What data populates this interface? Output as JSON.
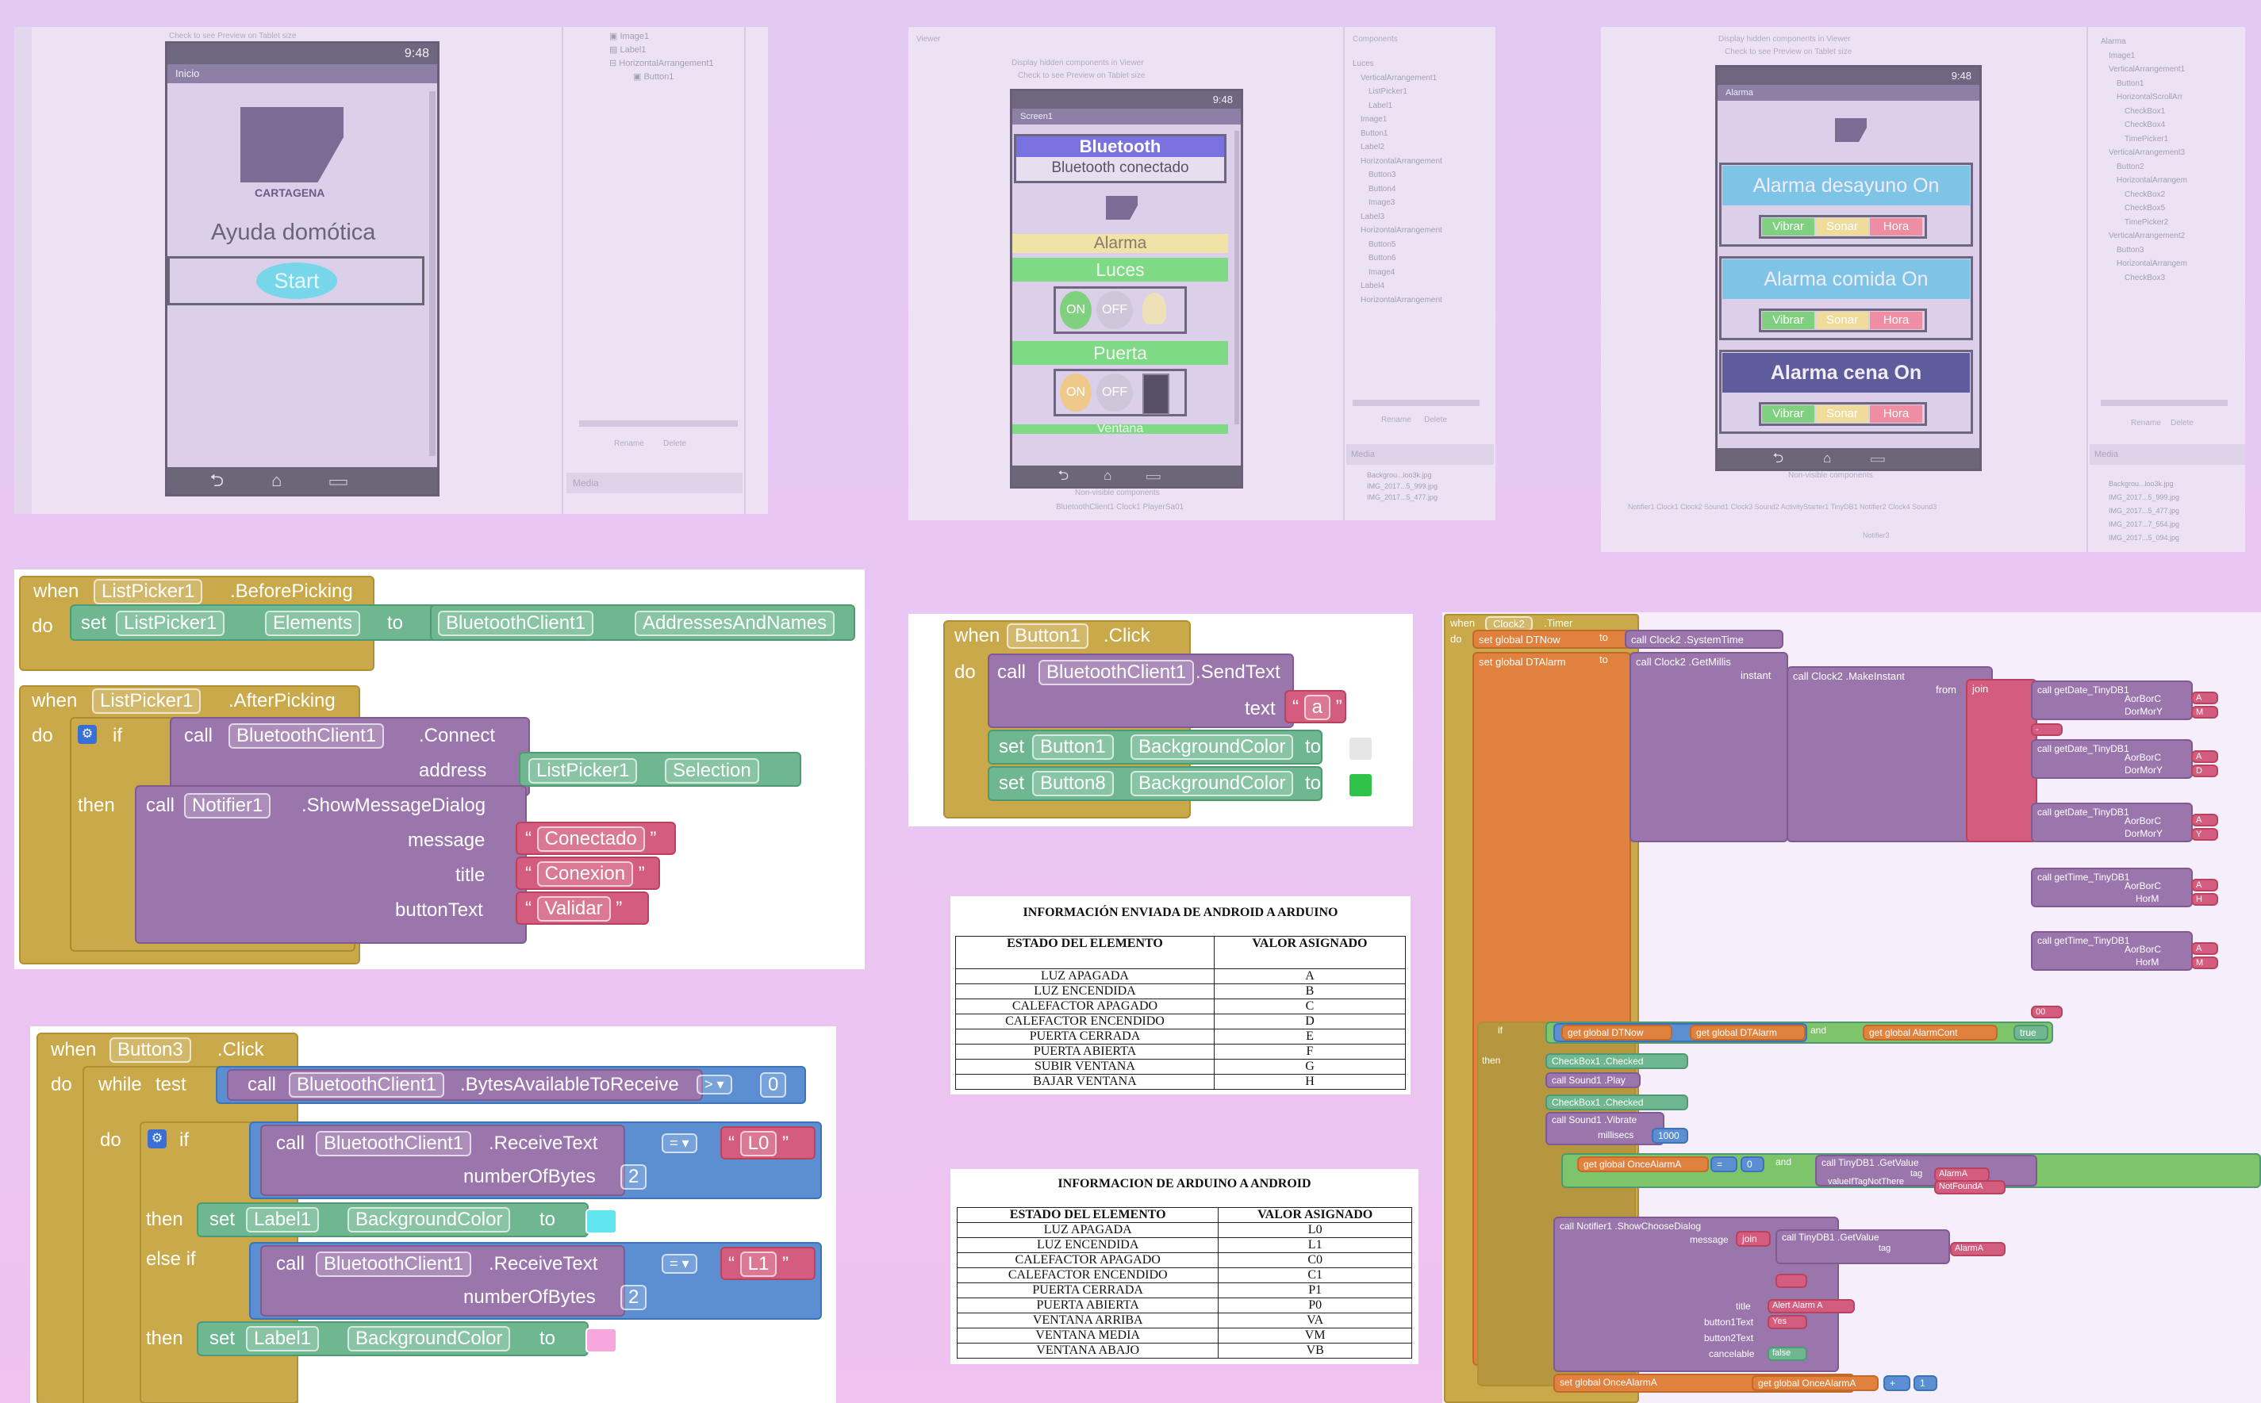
{
  "designer1": {
    "checkbox_label": "Check to see Preview on Tablet size",
    "status_time": "9:48",
    "screen_title": "Inicio",
    "logo_caption": "CARTAGENA",
    "heading": "Ayuda domótica",
    "start_button": "Start",
    "tree_items": [
      "Image1",
      "Label1",
      "HorizontalArrangement1",
      "Button1"
    ],
    "rename": "Rename",
    "delete": "Delete",
    "media": "Media"
  },
  "designer2": {
    "viewer": "Viewer",
    "components": "Components",
    "checkbox_hidden": "Display hidden components in Viewer",
    "checkbox_tablet": "Check to see Preview on Tablet size",
    "status_time": "9:48",
    "screen_title": "Screen1",
    "bluetooth_label": "Bluetooth",
    "bt_status": "Bluetooth conectado",
    "alarma": "Alarma",
    "luces": "Luces",
    "on": "ON",
    "off": "OFF",
    "puerta": "Puerta",
    "ventana": "Ventana",
    "nonvisible": "Non-visible components",
    "nonvisible_items": "BluetoothClient1  Clock1  PlayerSa01",
    "tree_items": [
      "Luces",
      "VerticalArrangement1",
      "ListPicker1",
      "Label1",
      "Image1",
      "Button1",
      "Label2",
      "HorizontalArrangement",
      "Button3",
      "Button4",
      "Image3",
      "Label3",
      "HorizontalArrangement",
      "Button5",
      "Button6",
      "Image4",
      "Label4",
      "HorizontalArrangement"
    ],
    "rename": "Rename",
    "delete": "Delete",
    "media": "Media",
    "media_items": [
      "Backgrou...loo3k.jpg",
      "IMG_2017...5_999.jpg",
      "IMG_2017...5_477.jpg"
    ]
  },
  "designer3": {
    "checkbox_hidden": "Display hidden components in Viewer",
    "checkbox_tablet": "Check to see Preview on Tablet size",
    "status_time": "9:48",
    "screen_title": "Alarma",
    "alarm1": "Alarma desayuno On",
    "alarm2": "Alarma comida On",
    "alarm3": "Alarma cena On",
    "vibrar": "Vibrar",
    "sonar": "Sonar",
    "hora": "Hora",
    "nonvisible": "Non-visible components",
    "nonvisible_items": "Notifier1  Clock1  Clock2  Sound1  Clock3  Sound2  ActivityStarter1  TinyDB1  Notifier2  Clock4  Sound3",
    "nonvisible_extra": "Notifier3",
    "tree_items": [
      "Alarma",
      "Image1",
      "VerticalArrangement1",
      "Button1",
      "HorizontalScrollArr",
      "CheckBox1",
      "CheckBox4",
      "TimePicker1",
      "VerticalArrangement3",
      "Button2",
      "HorizontalArrangem",
      "CheckBox2",
      "CheckBox5",
      "TimePicker2",
      "VerticalArrangement2",
      "Button3",
      "HorizontalArrangem",
      "CheckBox3"
    ],
    "rename": "Rename",
    "delete": "Delete",
    "media": "Media",
    "media_items": [
      "Backgrou...loo3k.jpg",
      "IMG_2017...5_999.jpg",
      "IMG_2017...5_477.jpg",
      "IMG_2017...7_554.jpg",
      "IMG_2017...5_094.jpg"
    ]
  },
  "block_listpicker": {
    "when": "when",
    "do": "do",
    "set": "set",
    "to": "to",
    "listpicker": "ListPicker1",
    "before_picking": ".BeforePicking",
    "elements": "Elements",
    "bt_client": "BluetoothClient1",
    "addresses": "AddressesAndNames",
    "after_picking": ".AfterPicking",
    "if": "if",
    "then": "then",
    "call": "call",
    "connect": ".Connect",
    "address": "address",
    "selection": "Selection",
    "notifier": "Notifier1",
    "show_dialog": ".ShowMessageDialog",
    "message": "message",
    "title": "title",
    "button_text": "buttonText",
    "msg_val": "Conectado",
    "title_val": "Conexion",
    "btn_val": "Validar"
  },
  "block_button1": {
    "when": "when",
    "do": "do",
    "call": "call",
    "set": "set",
    "to": "to",
    "button1": "Button1",
    "click": ".Click",
    "bt_client": "BluetoothClient1",
    "send_text": ".SendText",
    "text": "text",
    "text_val": "a",
    "bg_color": "BackgroundColor",
    "button8": "Button8",
    "color1": "#e6e6e6",
    "color2": "#2fc34a"
  },
  "block_button3": {
    "when": "when",
    "do": "do",
    "while": "while",
    "test": "test",
    "button3": "Button3",
    "click": ".Click",
    "call": "call",
    "bt_client": "BluetoothClient1",
    "bytes_avail": ".BytesAvailableToReceive",
    "gt": "> ▾",
    "zero": "0",
    "if": "if",
    "receive_text": ".ReceiveText",
    "num_bytes": "numberOfBytes",
    "two": "2",
    "eq": "= ▾",
    "l0": "L0",
    "l1": "L1",
    "then": "then",
    "else_if": "else if",
    "set": "set",
    "to": "to",
    "label1": "Label1",
    "bg_color": "BackgroundColor",
    "color_cyan": "#5fe6ef",
    "color_pink": "#f6a8dc"
  },
  "table1": {
    "title": "INFORMACIÓN ENVIADA DE ANDROID A ARDUINO",
    "headers": [
      "ESTADO DEL ELEMENTO",
      "VALOR ASIGNADO"
    ],
    "rows": [
      [
        "LUZ APAGADA",
        "A"
      ],
      [
        "LUZ ENCENDIDA",
        "B"
      ],
      [
        "CALEFACTOR APAGADO",
        "C"
      ],
      [
        "CALEFACTOR ENCENDIDO",
        "D"
      ],
      [
        "PUERTA CERRADA",
        "E"
      ],
      [
        "PUERTA ABIERTA",
        "F"
      ],
      [
        "SUBIR VENTANA",
        "G"
      ],
      [
        "BAJAR VENTANA",
        "H"
      ]
    ]
  },
  "table2": {
    "title": "INFORMACION DE ARDUINO A ANDROID",
    "headers": [
      "ESTADO DEL ELEMENTO",
      "VALOR ASIGNADO"
    ],
    "rows": [
      [
        "LUZ APAGADA",
        "L0"
      ],
      [
        "LUZ ENCENDIDA",
        "L1"
      ],
      [
        "CALEFACTOR APAGADO",
        "C0"
      ],
      [
        "CALEFACTOR ENCENDIDO",
        "C1"
      ],
      [
        "PUERTA CERRADA",
        "P1"
      ],
      [
        "PUERTA ABIERTA",
        "P0"
      ],
      [
        "VENTANA ARRIBA",
        "VA"
      ],
      [
        "VENTANA MEDIA",
        "VM"
      ],
      [
        "VENTANA ABAJO",
        "VB"
      ]
    ]
  },
  "block_clock": {
    "when": "when",
    "clock2": "Clock2",
    "timer": ".Timer",
    "do": "do",
    "set_dtnow": "set global DTNow",
    "to": "to",
    "call_clock2": "call Clock2",
    "system_time": ".SystemTime",
    "set_dtalarm": "set global DTAlarm",
    "get_millis": ".GetMillis",
    "instant": "instant",
    "make_instant": ".MakeInstant",
    "from": "from",
    "join": "join",
    "get_date": "call getDate_TinyDB1",
    "get_time": "call getTime_TinyDB1",
    "aorborc": "AorBorC",
    "dormory": "DorMorY",
    "horm": "HorM",
    "vals_a": "A",
    "vals_m": "M",
    "vals_d": "D",
    "vals_y": "Y",
    "vals_h": "H",
    "dash": "-",
    "space": " ",
    "colon": ":",
    "zero": "00",
    "if": "if",
    "then": "then",
    "get_dtnow": "get global DTNow",
    "get_dtalarm": "get global DTAlarm",
    "and": "and",
    "get_alarmcont": "get global AlarmCont",
    "true_val": "true",
    "checkbox1": "CheckBox1",
    "checked": ".Checked",
    "call_sound1": "call Sound1",
    "play": ".Play",
    "vibrate": ".Vibrate",
    "millisecs": "millisecs",
    "ms_val": "1000",
    "get_once": "get global OnceAlarmA",
    "eq": "=",
    "zero_val": "0",
    "tinydb_get": "call TinyDB1 .GetValue",
    "tag": "tag",
    "value_if": "valueIfTagNotThere",
    "alarma_a": "AlarmA",
    "not_found": "NotFoundA",
    "notifier": "call Notifier1 .ShowChooseDialog",
    "message": "message",
    "title": "title",
    "title_val": "Alert Alarm A",
    "button1text": "button1Text",
    "yes": "Yes",
    "button2text": "button2Text",
    "cancelable": "cancelable",
    "false_val": "false",
    "set_once": "set global OnceAlarmA",
    "get_once2": "get global OnceAlarmA",
    "plus": "+",
    "one": "1"
  }
}
